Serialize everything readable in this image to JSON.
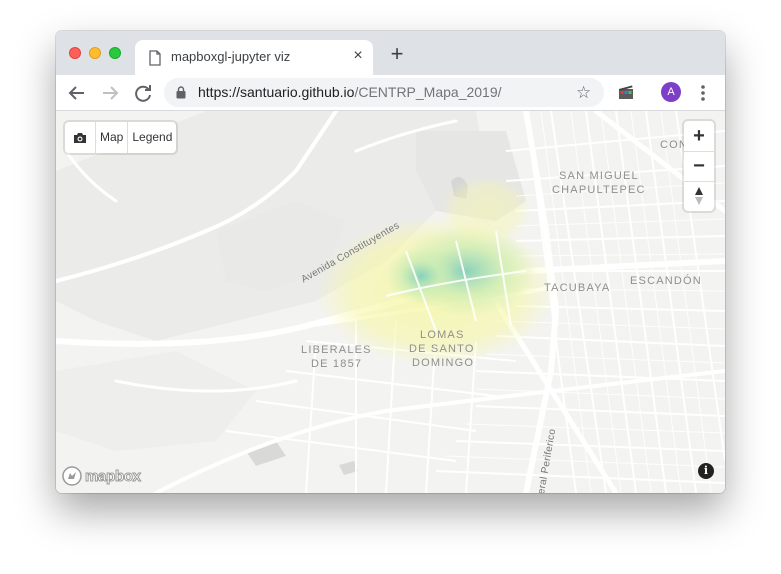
{
  "browser": {
    "tab_title": "mapboxgl-jupyter viz",
    "close_tab": "×",
    "new_tab": "+",
    "url_host": "https://santuario.github.io",
    "url_path": "/CENTRP_Mapa_2019/",
    "avatar_letter": "A",
    "star": "☆"
  },
  "map": {
    "controls": {
      "screenshot_icon": "camera-icon",
      "map_label": "Map",
      "legend_label": "Legend",
      "zoom_in": "+",
      "zoom_out": "−",
      "compass_icon": "compass-icon"
    },
    "labels": {
      "con": "CON",
      "san_miguel": "SAN MIGUEL",
      "chapultepec": "CHAPULTEPEC",
      "tacubaya": "TACUBAYA",
      "escandon": "ESCANDÓN",
      "lomas": "LOMAS",
      "de_santo": "DE SANTO",
      "domingo": "DOMINGO",
      "liberales": "LIBERALES",
      "de_1857": "DE 1857",
      "avenida": "Avenida Constituyentes",
      "periferico": "eral Periferico"
    },
    "logo_text": "mapbox",
    "info_symbol": "i",
    "heatmap_colors": [
      "#f6f7a8",
      "#c9ecb4",
      "#7fcdbb",
      "#41b6c4"
    ]
  }
}
